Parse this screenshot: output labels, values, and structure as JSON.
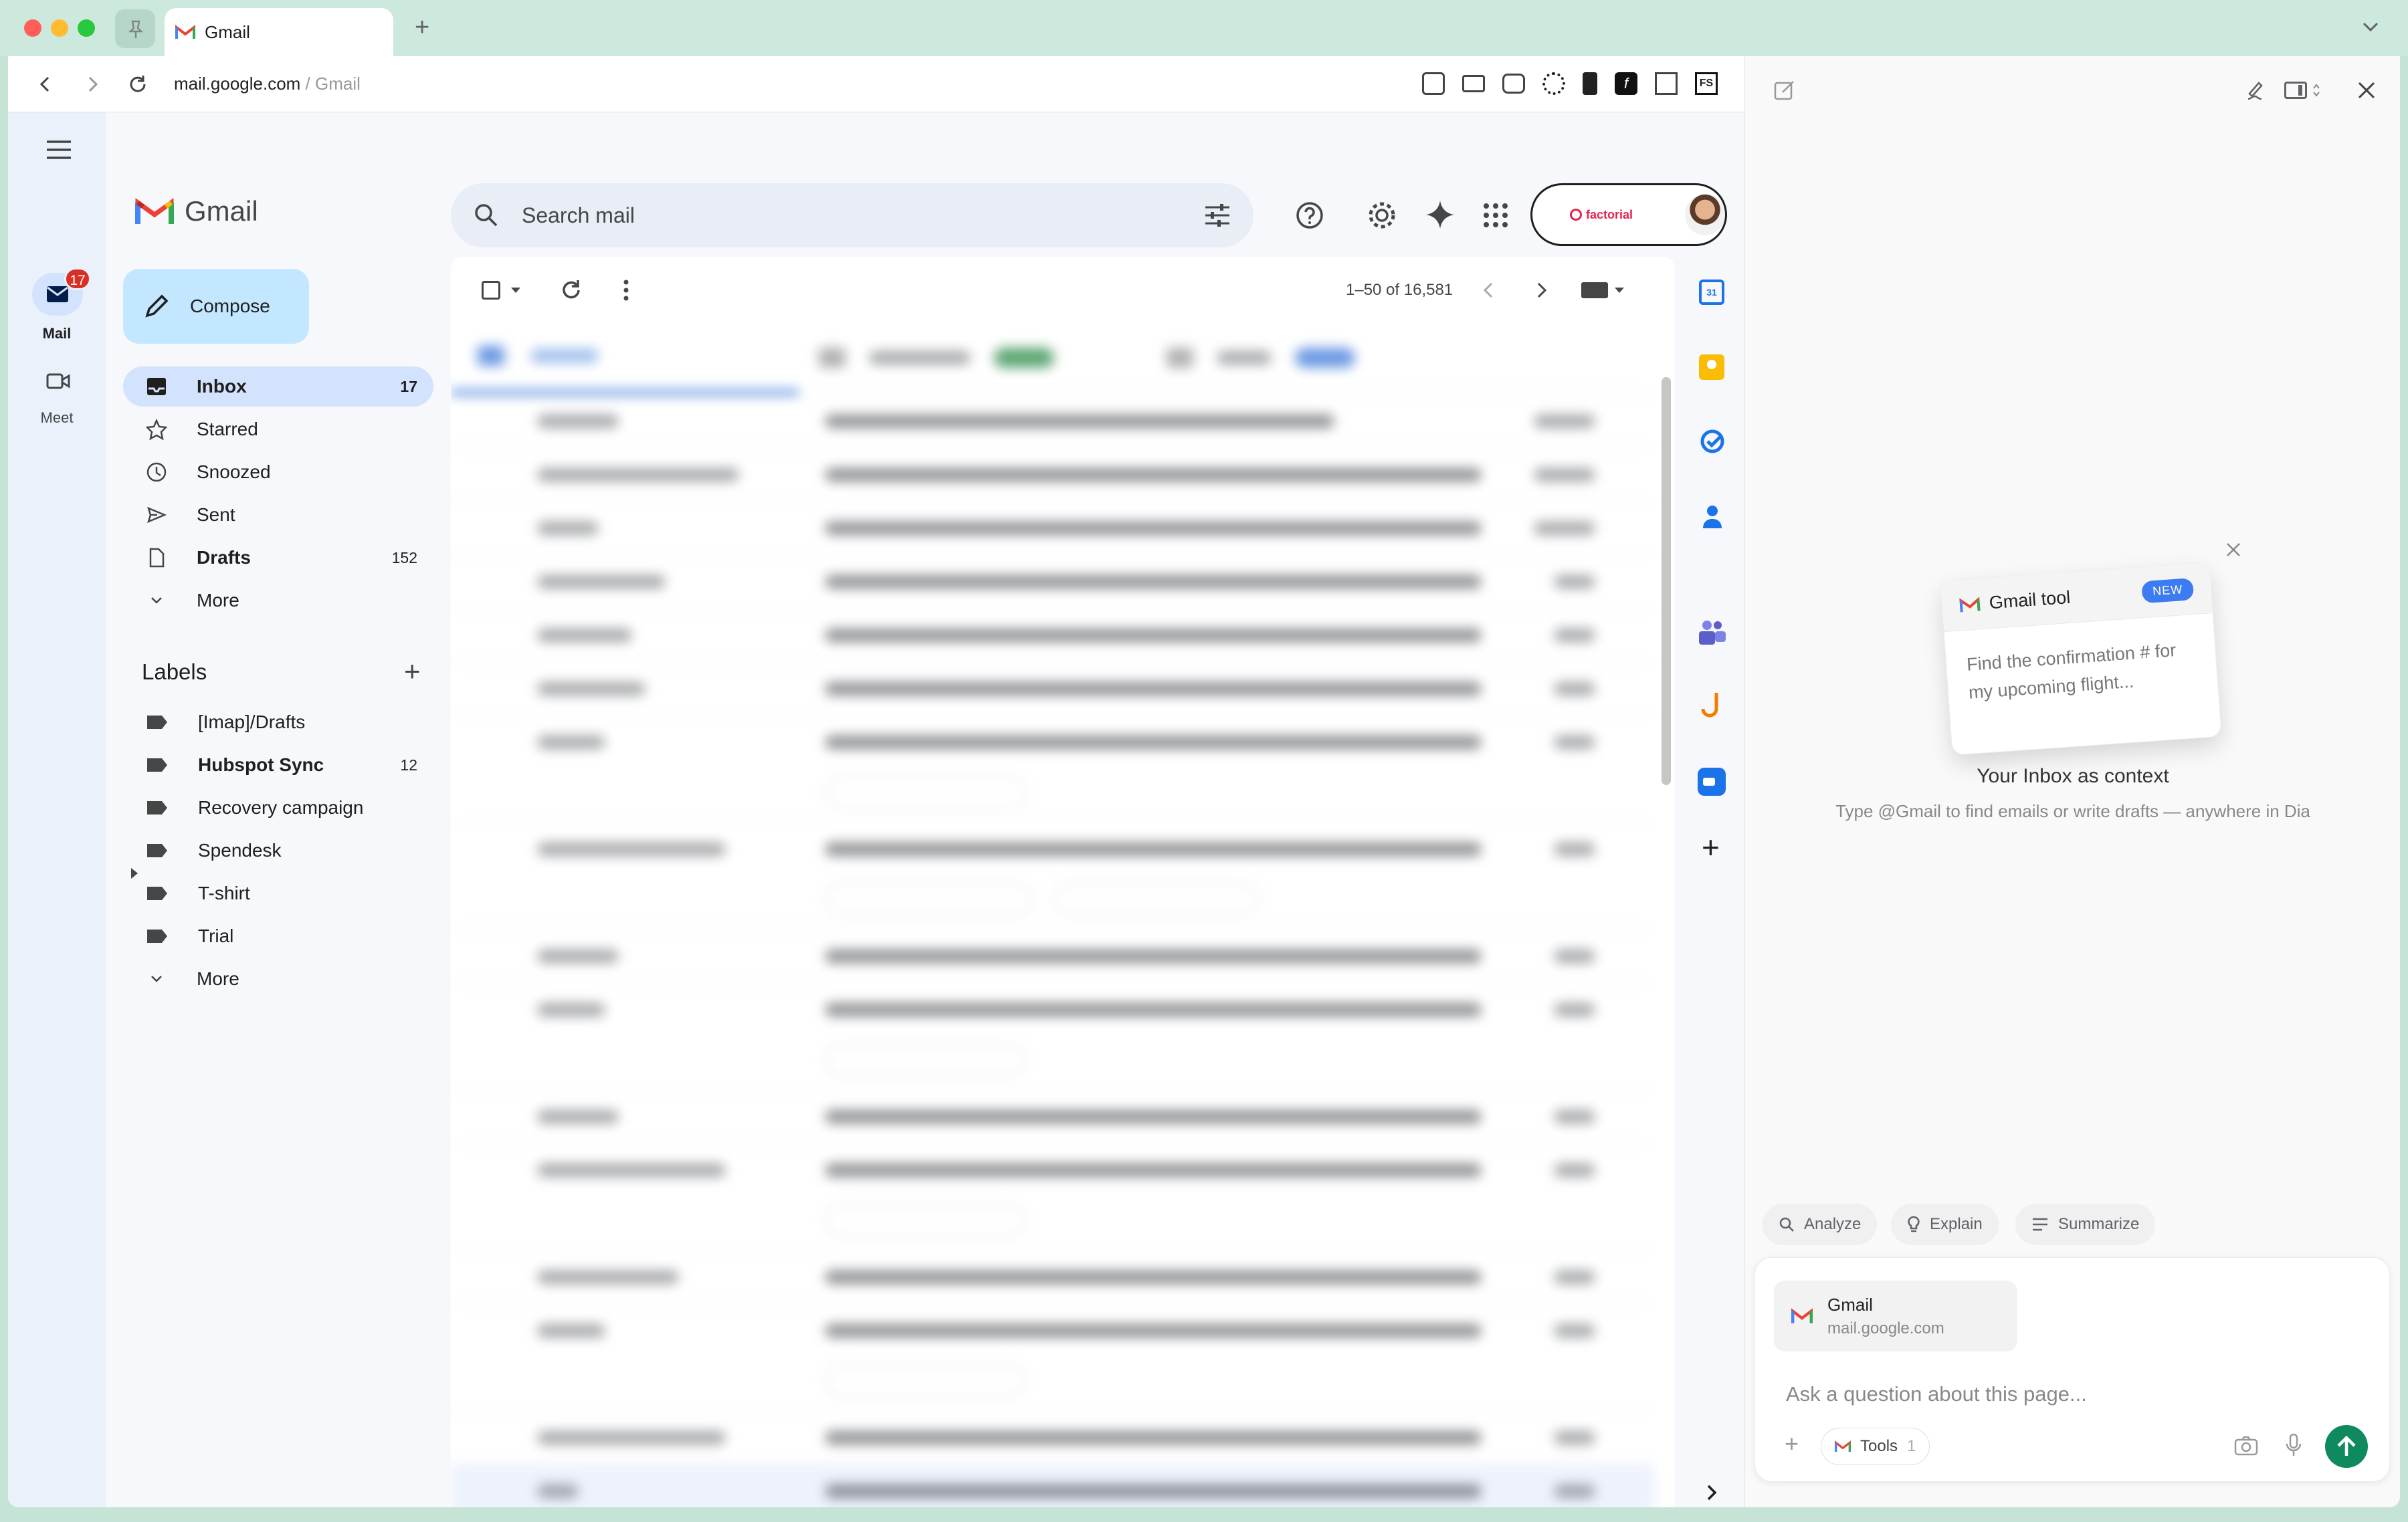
{
  "browser": {
    "tab_title": "Gmail",
    "url_host": "mail.google.com",
    "url_sep": " / ",
    "url_page": "Gmail"
  },
  "rail": {
    "mail_label": "Mail",
    "mail_badge": "17",
    "meet_label": "Meet"
  },
  "gmail": {
    "logo_text": "Gmail",
    "compose_label": "Compose",
    "search_placeholder": "Search mail",
    "factorial_text": "factorial",
    "pagination": "1–50 of 16,581",
    "nav": [
      {
        "label": "Inbox",
        "count": "17"
      },
      {
        "label": "Starred",
        "count": ""
      },
      {
        "label": "Snoozed",
        "count": ""
      },
      {
        "label": "Sent",
        "count": ""
      },
      {
        "label": "Drafts",
        "count": "152"
      },
      {
        "label": "More",
        "count": ""
      }
    ],
    "labels_title": "Labels",
    "labels": [
      {
        "label": "[Imap]/Drafts",
        "count": ""
      },
      {
        "label": "Hubspot Sync",
        "count": "12"
      },
      {
        "label": "Recovery campaign",
        "count": ""
      },
      {
        "label": "Spendesk",
        "count": ""
      },
      {
        "label": "T-shirt",
        "count": ""
      },
      {
        "label": "Trial",
        "count": ""
      },
      {
        "label": "More",
        "count": ""
      }
    ]
  },
  "assistant": {
    "card_title": "Gmail tool",
    "card_badge": "NEW",
    "card_example": "Find the confirmation # for my upcoming flight...",
    "heading": "Your Inbox as context",
    "subtitle": "Type @Gmail to find emails or write drafts — anywhere in Dia",
    "chips": [
      "Analyze",
      "Explain",
      "Summarize"
    ],
    "context_title": "Gmail",
    "context_url": "mail.google.com",
    "input_placeholder": "Ask a question about this page...",
    "tools_label": "Tools",
    "tools_count": "1"
  },
  "colors": {
    "accent": "#0b57d0",
    "compose_bg": "#c2e7ff",
    "inbox_active": "#d3e3fd",
    "badge_red": "#d93025",
    "send_green": "#0f8a5f"
  }
}
